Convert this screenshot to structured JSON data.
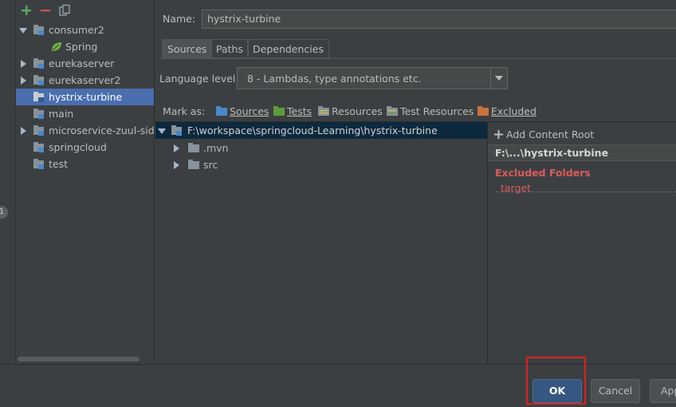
{
  "toolbar": {
    "add_icon": "plus-icon",
    "remove_icon": "minus-icon",
    "copy_icon": "copy-icon"
  },
  "gutter": {
    "badge": "1"
  },
  "modules": [
    {
      "label": "consumer2",
      "expanded": true
    },
    {
      "label": "Spring",
      "child": true
    },
    {
      "label": "eurekaserver"
    },
    {
      "label": "eurekaserver2"
    },
    {
      "label": "hystrix-turbine",
      "selected": true
    },
    {
      "label": "main"
    },
    {
      "label": "microservice-zuul-sidec"
    },
    {
      "label": "springcloud"
    },
    {
      "label": "test"
    }
  ],
  "name": {
    "label": "Name:",
    "value": "hystrix-turbine"
  },
  "tabs": [
    {
      "label": "Sources",
      "active": true
    },
    {
      "label": "Paths"
    },
    {
      "label": "Dependencies"
    }
  ],
  "language": {
    "label": "Language level:",
    "value": "8 - Lambdas, type annotations etc."
  },
  "mark_as": {
    "label": "Mark as:",
    "items": [
      "Sources",
      "Tests",
      "Resources",
      "Test Resources",
      "Excluded"
    ]
  },
  "file_tree": {
    "root": "F:\\workspace\\springcloud-Learning\\hystrix-turbine",
    "children": [
      ".mvn",
      "src"
    ]
  },
  "content_root": {
    "add_label": "Add Content Root",
    "path": "F:\\...\\hystrix-turbine",
    "excluded_heading": "Excluded Folders",
    "excluded_items": [
      "target"
    ]
  },
  "buttons": {
    "ok": "OK",
    "cancel": "Cancel",
    "apply": "Apply"
  },
  "colors": {
    "selection": "#4b6eaf",
    "folder_blue": "#4a88c7",
    "folder_green": "#5d9c3c",
    "folder_orange": "#c7733b",
    "excluded_red": "#db5c5c",
    "highlight_box": "#e02020"
  }
}
